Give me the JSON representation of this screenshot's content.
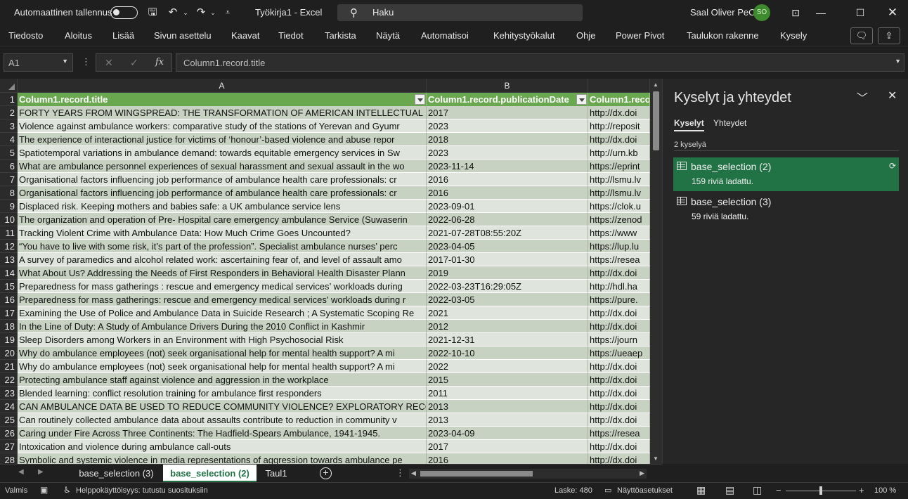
{
  "titlebar": {
    "autosave_label": "Automaattinen tallennus",
    "doc_title": "Työkirja1  -  Excel",
    "search_placeholder": "Haku",
    "user_name": "Saal Oliver PeO",
    "avatar_initials": "SO"
  },
  "ribbon": {
    "tabs": [
      "Tiedosto",
      "Aloitus",
      "Lisää",
      "Sivun asettelu",
      "Kaavat",
      "Tiedot",
      "Tarkista",
      "Näytä",
      "Automatisoi",
      "Kehitystyökalut",
      "Ohje",
      "Power Pivot",
      "Taulukon rakenne",
      "Kysely"
    ]
  },
  "formula": {
    "namebox": "A1",
    "fx": "fx",
    "content": "Column1.record.title"
  },
  "grid": {
    "col_headers": [
      "A",
      "B",
      ""
    ],
    "header_cells": [
      "Column1.record.title",
      "Column1.record.publicationDate",
      "Column1.reco"
    ],
    "rows": [
      {
        "n": "2",
        "a": "FORTY YEARS FROM WINGSPREAD: THE TRANSFORMATION OF AMERICAN INTELLECTUAL HISTO",
        "b": "2017",
        "c": "http://dx.doi"
      },
      {
        "n": "3",
        "a": "Violence against ambulance workers: comparative study of the stations of Yerevan and Gyumr",
        "b": "2023",
        "c": "http://reposit"
      },
      {
        "n": "4",
        "a": "The experience of interactional justice for victims of ‘honour’-based violence and abuse repor",
        "b": "2018",
        "c": "http://dx.doi"
      },
      {
        "n": "5",
        "a": "Spatiotemporal variations in ambulance demand: towards equitable emergency services in Sw",
        "b": "2023",
        "c": "http://urn.kb"
      },
      {
        "n": "6",
        "a": "What are ambulance personnel experiences of sexual harassment and sexual assault in the wo",
        "b": "2023-11-14",
        "c": "https://eprint"
      },
      {
        "n": "7",
        "a": "Organisational factors influencing job performance of ambulance health care professionals: cr",
        "b": "2016",
        "c": "http://lsmu.lv"
      },
      {
        "n": "8",
        "a": "Organisational factors influencing job performance of ambulance health care professionals: cr",
        "b": "2016",
        "c": "http://lsmu.lv"
      },
      {
        "n": "9",
        "a": "Displaced risk. Keeping mothers and babies safe: a UK ambulance service lens",
        "b": "2023-09-01",
        "c": "https://clok.u"
      },
      {
        "n": "10",
        "a": "The organization and operation of Pre- Hospital care emergency ambulance Service (Suwaserin",
        "b": "2022-06-28",
        "c": "https://zenod"
      },
      {
        "n": "11",
        "a": "Tracking Violent Crime with Ambulance Data: How Much Crime Goes Uncounted?",
        "b": "2021-07-28T08:55:20Z",
        "c": "https://www"
      },
      {
        "n": "12",
        "a": "“You have to live with some risk, it’s part of the profession”. Specialist ambulance nurses’ perc",
        "b": "2023-04-05",
        "c": "https://lup.lu"
      },
      {
        "n": "13",
        "a": "A survey of paramedics and alcohol related work: ascertaining fear of, and level of assault amo",
        "b": "2017-01-30",
        "c": "https://resea"
      },
      {
        "n": "14",
        "a": "What About Us? Addressing the Needs of First Responders in Behavioral Health Disaster Plann",
        "b": "2019",
        "c": "http://dx.doi"
      },
      {
        "n": "15",
        "a": "Preparedness for mass gatherings : rescue and emergency medical services’ workloads during",
        "b": "2022-03-23T16:29:05Z",
        "c": "http://hdl.ha"
      },
      {
        "n": "16",
        "a": "Preparedness for mass gatherings: rescue and emergency medical services' workloads during r",
        "b": "2022-03-05",
        "c": "https://pure."
      },
      {
        "n": "17",
        "a": "Examining the Use of Police and Ambulance Data in Suicide Research ; A Systematic Scoping Re",
        "b": "2021",
        "c": "http://dx.doi"
      },
      {
        "n": "18",
        "a": "In the Line of Duty: A Study of Ambulance Drivers During the 2010 Conflict in Kashmir",
        "b": "2012",
        "c": "http://dx.doi"
      },
      {
        "n": "19",
        "a": "Sleep Disorders among Workers in an Environment with High Psychosocial Risk",
        "b": "2021-12-31",
        "c": "https://journ"
      },
      {
        "n": "20",
        "a": "Why do ambulance employees (not) seek organisational help for mental health support? A mi",
        "b": "2022-10-10",
        "c": "https://ueaep"
      },
      {
        "n": "21",
        "a": "Why do ambulance employees (not) seek organisational help for mental health support? A mi",
        "b": "2022",
        "c": "http://dx.doi"
      },
      {
        "n": "22",
        "a": "Protecting ambulance staff against violence and aggression in the workplace",
        "b": "2015",
        "c": "http://dx.doi"
      },
      {
        "n": "23",
        "a": "Blended learning: conflict resolution training for ambulance first responders",
        "b": "2011",
        "c": "http://dx.doi"
      },
      {
        "n": "24",
        "a": "CAN AMBULANCE DATA BE USED TO REDUCE COMMUNITY VIOLENCE? EXPLORATORY RECORD LI",
        "b": "2013",
        "c": "http://dx.doi"
      },
      {
        "n": "25",
        "a": "Can routinely collected ambulance data about assaults contribute to reduction in community v",
        "b": "2013",
        "c": "http://dx.doi"
      },
      {
        "n": "26",
        "a": "Caring under Fire Across Three Continents: The Hadfield-Spears Ambulance, 1941-1945.",
        "b": "2023-04-09",
        "c": "https://resea"
      },
      {
        "n": "27",
        "a": "Intoxication and violence during ambulance call-outs",
        "b": "2017",
        "c": "http://dx.doi"
      },
      {
        "n": "28",
        "a": "Symbolic and systemic violence in media representations of aggression towards ambulance pe",
        "b": "2016",
        "c": "http://dx.doi"
      }
    ]
  },
  "pane": {
    "title": "Kyselyt ja yhteydet",
    "tab_queries": "Kyselyt",
    "tab_connections": "Yhteydet",
    "count": "2 kyselyä",
    "items": [
      {
        "name": "base_selection (2)",
        "rows": "159 riviä ladattu."
      },
      {
        "name": "base_selection (3)",
        "rows": "59 riviä ladattu."
      }
    ]
  },
  "sheets": {
    "tabs": [
      "base_selection (3)",
      "base_selection (2)",
      "Taul1"
    ],
    "active": "base_selection (2)"
  },
  "status": {
    "ready": "Valmis",
    "accessibility": "Helppokäyttöisyys: tutustu suosituksiin",
    "count": "Laske: 480",
    "display_settings": "Näyttöasetukset",
    "zoom": "100 %"
  },
  "colors": {
    "header_green": "#6aa84f",
    "row_band_dark": "#c8d2c2",
    "row_band_light": "#dfe5dc",
    "selected_query": "#217346"
  }
}
